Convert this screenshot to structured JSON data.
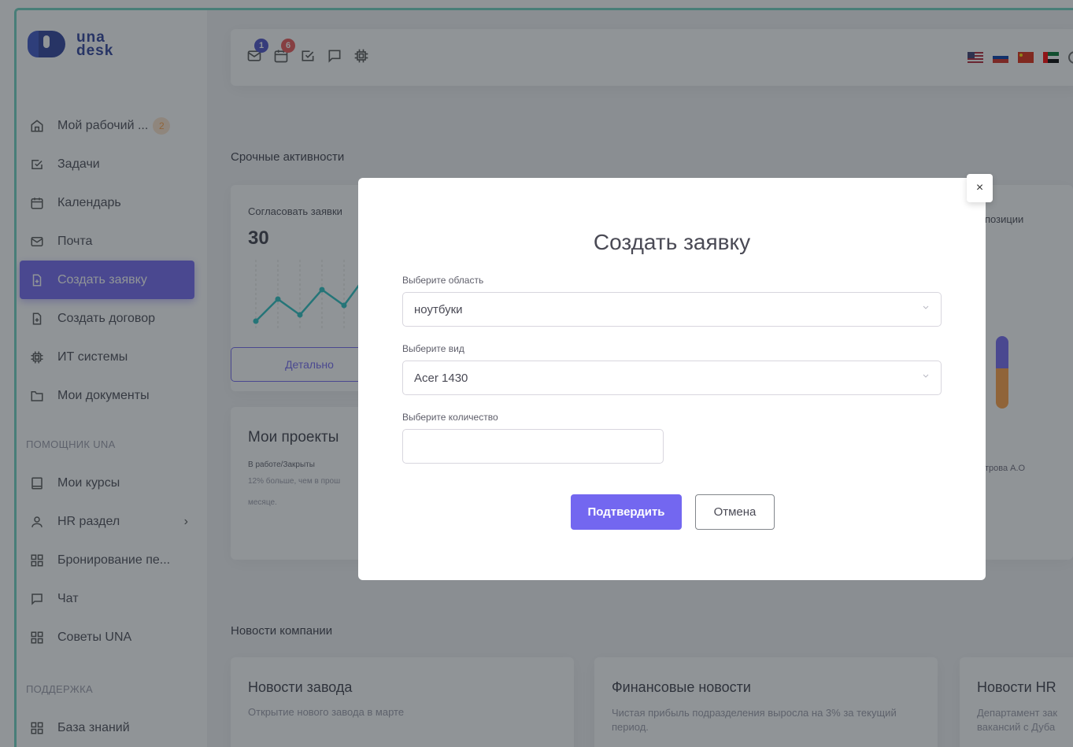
{
  "logo": {
    "line1": "una",
    "line2": "desk"
  },
  "sidebar": {
    "items": [
      {
        "label": "Мой рабочий ...",
        "badge": "2",
        "icon": "home-icon"
      },
      {
        "label": "Задачи",
        "icon": "check-square-icon"
      },
      {
        "label": "Календарь",
        "icon": "calendar-icon"
      },
      {
        "label": "Почта",
        "icon": "mail-icon"
      },
      {
        "label": "Создать заявку",
        "icon": "file-plus-icon",
        "active": true
      },
      {
        "label": "Создать договор",
        "icon": "file-plus-icon"
      },
      {
        "label": "ИТ системы",
        "icon": "cpu-icon"
      },
      {
        "label": "Мои документы",
        "icon": "folder-icon"
      }
    ],
    "section_assistant": "ПОМОЩНИК UNA",
    "assistant_items": [
      {
        "label": "Мои курсы",
        "icon": "tablet-icon"
      },
      {
        "label": "HR раздел",
        "icon": "user-icon"
      },
      {
        "label": "Бронирование пе...",
        "icon": "grid-icon"
      },
      {
        "label": "Чат",
        "icon": "message-icon"
      },
      {
        "label": "Советы UNA",
        "icon": "grid-icon"
      }
    ],
    "section_support": "ПОДДЕРЖКА",
    "support_items": [
      {
        "label": "База знаний",
        "icon": "grid-icon"
      }
    ]
  },
  "topbar": {
    "mail_badge": "1",
    "calendar_badge": "6"
  },
  "urgent": {
    "title": "Срочные активности",
    "card1_title": "Согласовать заявки",
    "card1_value": "30",
    "card1_button": "Детально",
    "card3_title": "позиции",
    "card3_person": "трова А.О"
  },
  "projects": {
    "title": "Мои проекты",
    "subtitle": "В работе/Закрыты",
    "note_line1": "12% больше, чем в прош",
    "note_line2": "месяце."
  },
  "news": {
    "title": "Новости компании",
    "items": [
      {
        "title": "Новости завода",
        "text": "Открытие нового завода в марте"
      },
      {
        "title": "Финансовые новости",
        "text": "Чистая прибыль подразделения выросла на 3% за текущий период."
      },
      {
        "title": "Новости HR",
        "text": "Департамент зак вакансий с Дуба"
      }
    ]
  },
  "modal": {
    "title": "Создать заявку",
    "close": "×",
    "field_area_label": "Выберите область",
    "field_area_value": "ноутбуки",
    "field_type_label": "Выберите вид",
    "field_type_value": "Acer 1430",
    "field_qty_label": "Выберите количество",
    "field_qty_value": "",
    "confirm": "Подтвердить",
    "cancel": "Отмена"
  },
  "colors": {
    "primary": "#7367f0",
    "accent_border": "#6fd3c0",
    "badge_orange": "#ff9f43"
  }
}
